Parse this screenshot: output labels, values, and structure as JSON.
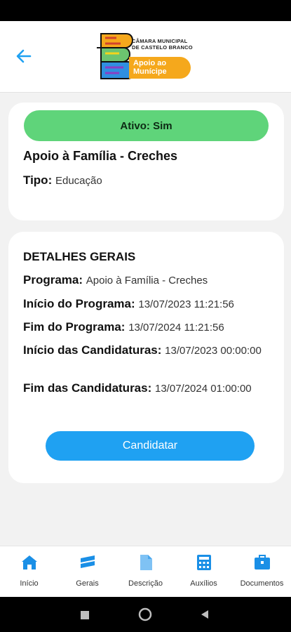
{
  "header": {
    "back_icon": "arrow-left-icon",
    "logo": {
      "org_name": "CÂMARA MUNICIPAL\nDE CASTELO BRANCO",
      "app_line1": "Apoio ao",
      "app_line2": "Munícipe"
    }
  },
  "summary": {
    "status": "Ativo: Sim",
    "program_title": "Apoio à Família - Creches",
    "type_label": "Tipo:",
    "type_value": "Educação"
  },
  "details": {
    "title": "DETALHES GERAIS",
    "rows": [
      {
        "label": "Programa:",
        "value": "Apoio à Família - Creches"
      },
      {
        "label": "Início do Programa:",
        "value": "13/07/2023 11:21:56"
      },
      {
        "label": "Fim do Programa:",
        "value": "13/07/2024 11:21:56"
      },
      {
        "label": "Início das Candidaturas:",
        "value": "13/07/2023 00:00:00"
      },
      {
        "label": "Fim das Candidaturas:",
        "value": "13/07/2024 01:00:00"
      }
    ],
    "apply_label": "Candidatar"
  },
  "tabs": [
    {
      "label": "Início",
      "icon": "home-icon"
    },
    {
      "label": "Gerais",
      "icon": "layers-icon"
    },
    {
      "label": "Descrição",
      "icon": "document-icon"
    },
    {
      "label": "Auxílios",
      "icon": "calculator-icon"
    },
    {
      "label": "Documentos",
      "icon": "briefcase-icon"
    }
  ],
  "colors": {
    "accent": "#1fa1f2",
    "status_green": "#5fd47a",
    "logo_orange": "#f5a81c"
  }
}
